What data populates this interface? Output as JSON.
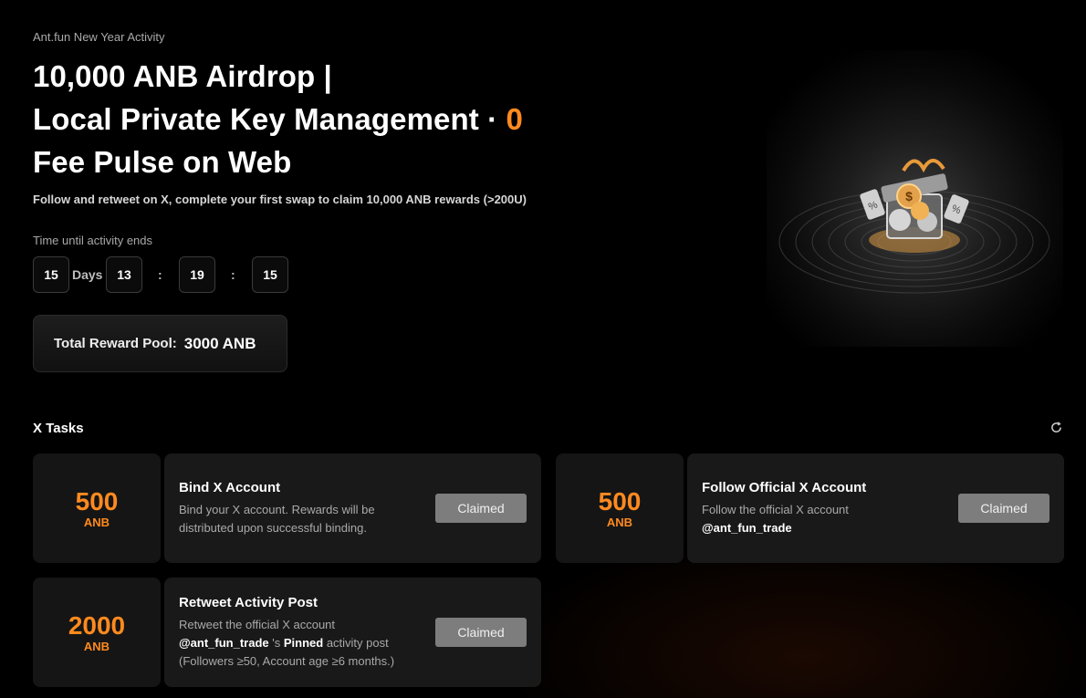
{
  "hero": {
    "eyebrow": "Ant.fun New Year Activity",
    "title_line1": "10,000 ANB Airdrop |",
    "title_line2": "Local Private Key Management · ",
    "title_accent": "0",
    "title_line3": "Fee Pulse on Web",
    "subtitle": "Follow and retweet on X, complete your first swap to claim 10,000 ANB rewards (>200U)",
    "countdown_label": "Time until activity ends",
    "countdown": {
      "days": "15",
      "days_label": "Days",
      "hours": "13",
      "minutes": "19",
      "seconds": "15",
      "separator": ":"
    },
    "pool_label": "Total Reward Pool:",
    "pool_value": "3000 ANB",
    "image_icon": "gift-box-coins-icon"
  },
  "tasks_section": {
    "title": "X Tasks",
    "refresh_icon": "refresh-icon",
    "tasks": [
      {
        "reward": "500",
        "unit": "ANB",
        "title": "Bind X Account",
        "desc": "Bind your X account. Rewards will be distributed upon successful binding.",
        "button": "Claimed"
      },
      {
        "reward": "500",
        "unit": "ANB",
        "title": "Follow Official X Account",
        "desc": "Follow the official X account",
        "handle": "@ant_fun_trade",
        "button": "Claimed"
      },
      {
        "reward": "2000",
        "unit": "ANB",
        "title": "Retweet Activity Post",
        "desc_prefix": "Retweet the official X account",
        "handle": "@ant_fun_trade",
        "desc_mid": " 's ",
        "pinned": "Pinned",
        "desc_suffix": " activity post",
        "desc_note": "(Followers ≥50, Account age ≥6 months.)",
        "button": "Claimed"
      }
    ]
  },
  "colors": {
    "accent": "#ff8a1f",
    "background": "#000000",
    "card": "#191919",
    "button": "#7d7d7d"
  }
}
